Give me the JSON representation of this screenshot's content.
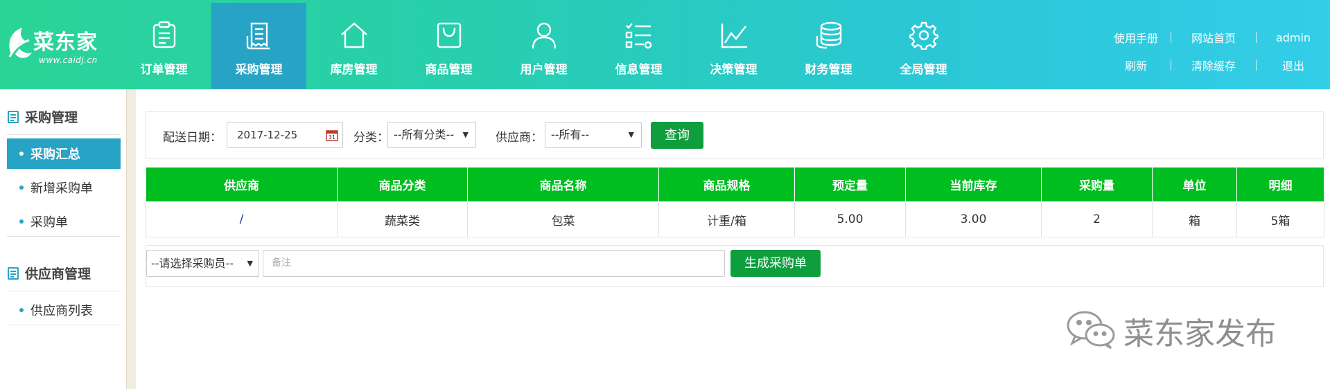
{
  "brand": {
    "name": "菜东家",
    "url": "www.caidj.cn"
  },
  "nav": [
    {
      "label": "订单管理",
      "icon": "clipboard-icon",
      "active": false
    },
    {
      "label": "采购管理",
      "icon": "receipt-icon",
      "active": true
    },
    {
      "label": "库房管理",
      "icon": "house-icon",
      "active": false
    },
    {
      "label": "商品管理",
      "icon": "shopping-bag-icon",
      "active": false
    },
    {
      "label": "用户管理",
      "icon": "user-icon",
      "active": false
    },
    {
      "label": "信息管理",
      "icon": "checklist-icon",
      "active": false
    },
    {
      "label": "决策管理",
      "icon": "line-chart-icon",
      "active": false
    },
    {
      "label": "财务管理",
      "icon": "coins-icon",
      "active": false
    },
    {
      "label": "全局管理",
      "icon": "gear-icon",
      "active": false
    }
  ],
  "top_links": {
    "manual": "使用手册",
    "home": "网站首页",
    "user": "admin",
    "refresh": "刷新",
    "clear_cache": "清除缓存",
    "logout": "退出"
  },
  "sidebar": {
    "sections": [
      {
        "title": "采购管理",
        "items": [
          {
            "label": "采购汇总",
            "active": true
          },
          {
            "label": "新增采购单",
            "active": false
          },
          {
            "label": "采购单",
            "active": false
          }
        ]
      },
      {
        "title": "供应商管理",
        "items": [
          {
            "label": "供应商列表",
            "active": false
          }
        ]
      }
    ]
  },
  "filter": {
    "date_label": "配送日期：",
    "date_value": "2017-12-25",
    "category_label": "分类：",
    "category_value": "--所有分类--",
    "supplier_label": "供应商：",
    "supplier_value": "--所有--",
    "query_button": "查询"
  },
  "table": {
    "headers": [
      "供应商",
      "商品分类",
      "商品名称",
      "商品规格",
      "预定量",
      "当前库存",
      "采购量",
      "单位",
      "明细"
    ],
    "rows": [
      [
        "/",
        "蔬菜类",
        "包菜",
        "计重/箱",
        "5.00",
        "3.00",
        "2",
        "箱",
        "5箱"
      ]
    ]
  },
  "generate": {
    "buyer_placeholder": "--请选择采购员--",
    "remark_placeholder": "备注",
    "button": "生成采购单"
  },
  "watermark": "菜东家发布",
  "colors": {
    "header_start": "#2ad497",
    "header_end": "#33cde8",
    "active_nav": "#27a4c5",
    "table_header": "#00bd20",
    "button_green": "#0f9e3e"
  }
}
